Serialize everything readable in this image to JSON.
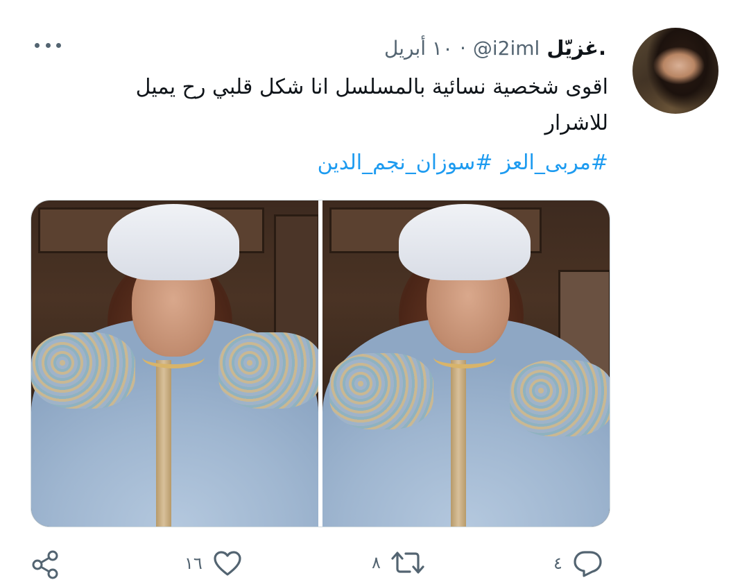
{
  "tweet": {
    "display_name": "غزيّل.",
    "handle": "@i2iml",
    "separator": "·",
    "date": "١٠ أبريل",
    "text_line1": "اقوى شخصية نسائية بالمسلسل انا شكل قلبي رح يميل",
    "text_line2": "للاشرار",
    "hashtags": [
      "#مربى_العز",
      "#سوزان_نجم_الدين"
    ]
  },
  "actions": {
    "reply_count": "٤",
    "retweet_count": "٨",
    "like_count": "١٦"
  },
  "icons": {
    "more": "more-horizontal-icon",
    "reply": "reply-icon",
    "retweet": "retweet-icon",
    "like": "heart-icon",
    "share": "share-icon"
  },
  "colors": {
    "hashtag": "#1d9bf0",
    "secondary_text": "#536471",
    "primary_text": "#0f1419"
  }
}
